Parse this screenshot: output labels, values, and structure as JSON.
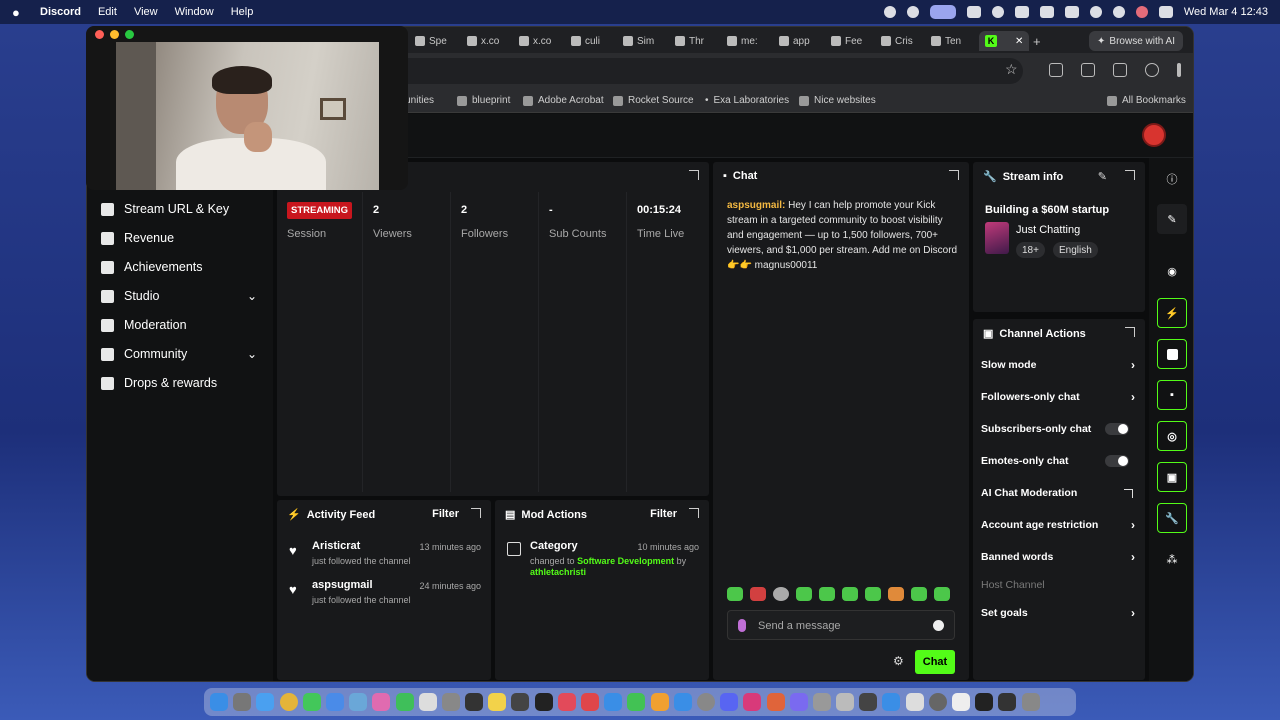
{
  "menubar": {
    "app": "Discord",
    "items": [
      "Edit",
      "View",
      "Window",
      "Help"
    ],
    "clock": "Wed Mar 4  12:43"
  },
  "browser": {
    "tabs": [
      "Spe",
      "x.co",
      "x.co",
      "culi",
      "Sim",
      "Thr",
      "me:",
      "app",
      "Fee",
      "Cris",
      "Ten"
    ],
    "browse_ai": "Browse with AI",
    "bookmarks": [
      "rtunities",
      "blueprint",
      "Adobe Acrobat",
      "Rocket Source",
      "Exa Laboratories",
      "Nice websites",
      "All Bookmarks"
    ]
  },
  "sidenav": {
    "items": [
      {
        "label": "Stream URL & Key",
        "icon": "link-icon"
      },
      {
        "label": "Revenue",
        "icon": "chart-icon"
      },
      {
        "label": "Achievements",
        "icon": "trophy-icon"
      },
      {
        "label": "Studio",
        "icon": "studio-icon",
        "expandable": true
      },
      {
        "label": "Moderation",
        "icon": "wrench-icon"
      },
      {
        "label": "Community",
        "icon": "people-icon",
        "expandable": true
      },
      {
        "label": "Drops & rewards",
        "icon": "gift-icon"
      }
    ]
  },
  "stats": {
    "status_badge": "STREAMING",
    "session_label": "Session",
    "viewers_value": "2",
    "viewers_label": "Viewers",
    "followers_value": "2",
    "followers_label": "Followers",
    "subs_value": "-",
    "subs_label": "Sub Counts",
    "time_value": "00:15:24",
    "time_label": "Time Live"
  },
  "activity_feed": {
    "title": "Activity Feed",
    "filter": "Filter",
    "items": [
      {
        "name": "Aristicrat",
        "time": "13 minutes ago",
        "action": "just followed the channel"
      },
      {
        "name": "aspsugmail",
        "time": "24 minutes ago",
        "action": "just followed the channel"
      }
    ]
  },
  "mod_actions": {
    "title": "Mod Actions",
    "filter": "Filter",
    "item": {
      "name": "Category",
      "time": "10 minutes ago",
      "prefix": "changed to",
      "category": "Software Development",
      "by": "by",
      "user": "athletachristi"
    }
  },
  "chat": {
    "title": "Chat",
    "message_user": "aspsugmail:",
    "message_text": " Hey I can help promote your Kick stream in a targeted community to boost visibility and engagement — up to 1,500 followers, 700+ viewers, and $1,000 per stream. Add me on Discord👉👉 magnus00011",
    "input_placeholder": "Send a message",
    "send_label": "Chat"
  },
  "stream_info": {
    "title": "Stream info",
    "stream_title": "Building a $60M startup",
    "category": "Just Chatting",
    "tags": [
      "18+",
      "English"
    ]
  },
  "channel_actions": {
    "title": "Channel Actions",
    "items": [
      {
        "label": "Slow mode",
        "control": "arrow"
      },
      {
        "label": "Followers-only chat",
        "control": "arrow"
      },
      {
        "label": "Subscribers-only chat",
        "control": "toggle",
        "value": false
      },
      {
        "label": "Emotes-only chat",
        "control": "toggle",
        "value": false
      },
      {
        "label": "AI Chat Moderation",
        "control": "external"
      },
      {
        "label": "Account age restriction",
        "control": "arrow"
      },
      {
        "label": "Banned words",
        "control": "arrow"
      },
      {
        "label": "Host Channel",
        "control": "none",
        "disabled": true
      },
      {
        "label": "Set goals",
        "control": "arrow"
      }
    ]
  },
  "colors": {
    "accent": "#53fc18",
    "live": "#c8161e",
    "panel": "#18191b",
    "chat_user": "#f4b942"
  }
}
